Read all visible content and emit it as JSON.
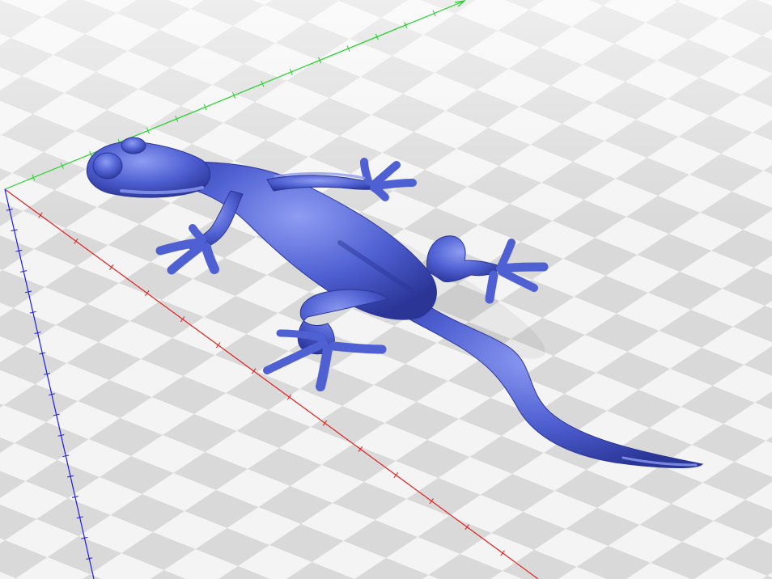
{
  "scene": {
    "subject_icon": "gecko-icon",
    "floor_pattern": "checkerboard",
    "colors": {
      "model": "#4f60d2",
      "model_highlight": "#8e9cf2",
      "model_shadow": "#2a3596",
      "floor_light": "#f4f4f4",
      "floor_dark": "#d9d9d9",
      "axis_x": "#e0201c",
      "axis_y": "#22d02a",
      "axis_z": "#1c1ce0"
    },
    "axes": [
      {
        "name": "x",
        "color": "#e0201c"
      },
      {
        "name": "y",
        "color": "#22d02a"
      },
      {
        "name": "z",
        "color": "#1c1ce0"
      }
    ]
  }
}
